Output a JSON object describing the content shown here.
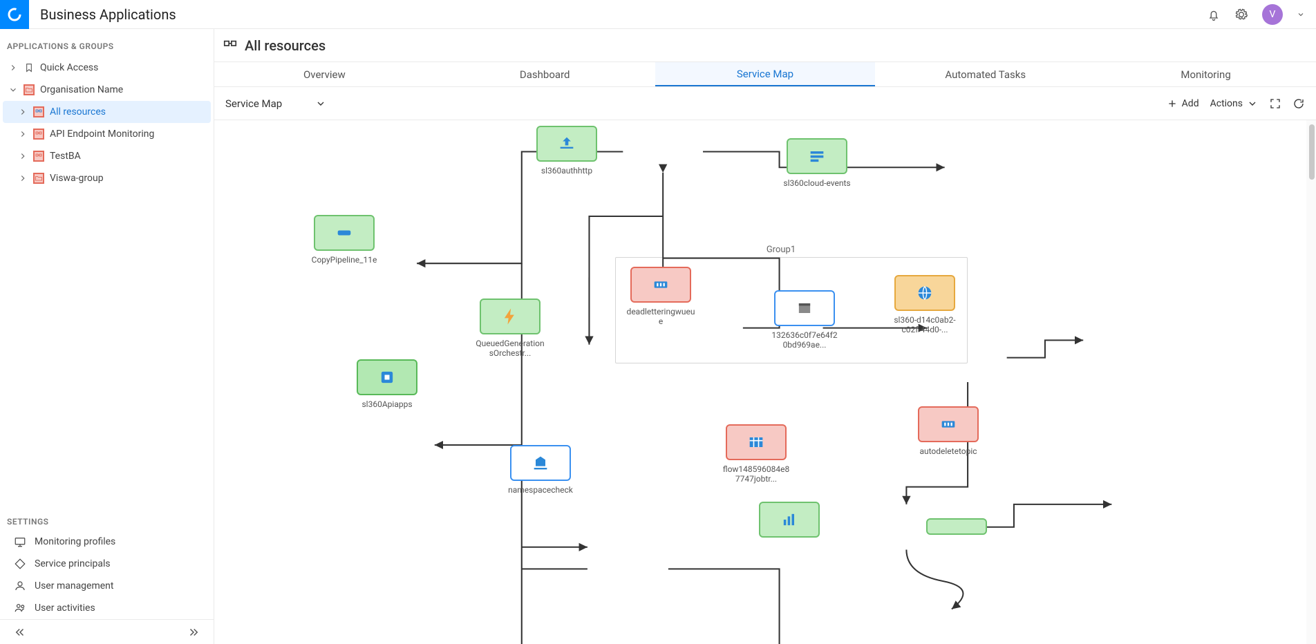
{
  "header": {
    "app_title": "Business Applications",
    "avatar_letter": "V"
  },
  "sidebar": {
    "section_title": "APPLICATIONS & GROUPS",
    "quick_access": "Quick Access",
    "org_name": "Organisation Name",
    "items": [
      {
        "label": "All resources"
      },
      {
        "label": "API Endpoint Monitoring"
      },
      {
        "label": "TestBA"
      },
      {
        "label": "Viswa-group"
      }
    ],
    "settings_title": "SETTINGS",
    "settings": [
      {
        "label": "Monitoring profiles"
      },
      {
        "label": "Service principals"
      },
      {
        "label": "User management"
      },
      {
        "label": "User activities"
      }
    ]
  },
  "page": {
    "title": "All resources",
    "tabs": [
      "Overview",
      "Dashboard",
      "Service Map",
      "Automated Tasks",
      "Monitoring"
    ],
    "active_tab": "Service Map",
    "toolbar": {
      "view_selector": "Service Map",
      "add": "Add",
      "actions": "Actions"
    }
  },
  "servicemap": {
    "group_label": "Group1",
    "nodes": {
      "sl360authhttp": "sl360authhttp",
      "sl360cloudevents": "sl360cloud-events",
      "copypipeline": "CopyPipeline_11e",
      "queuedgen": "QueuedGenerationsOrchestr...",
      "sl360apiapps": "sl360Apiapps",
      "namespacecheck": "namespacecheck",
      "deadletter": "deadletteringwueue",
      "guid": "132636c0f7e64f20bd969ae...",
      "sl360d14": "sl360-d14c0ab2-c02f-44d0-...",
      "flow148": "flow148596084e87747jobtr...",
      "autodelete": "autodeletetopic"
    }
  }
}
